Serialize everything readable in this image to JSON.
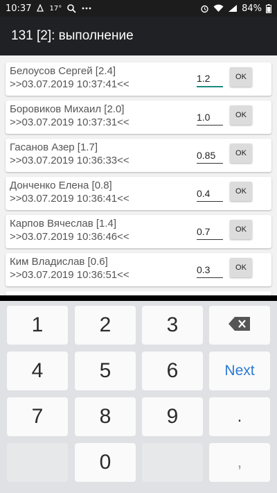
{
  "status_bar": {
    "time": "10:37",
    "temp": "17°",
    "battery": "84%"
  },
  "app_bar": {
    "title": "131 [2]: выполнение"
  },
  "items": [
    {
      "name": "Белоусов Сергей [2.4]",
      "time": ">>03.07.2019 10:37:41<<",
      "value": "1.2",
      "ok": "OK"
    },
    {
      "name": "Боровиков Михаил [2.0]",
      "time": ">>03.07.2019 10:37:31<<",
      "value": "1.0",
      "ok": "OK"
    },
    {
      "name": "Гасанов Азер [1.7]",
      "time": ">>03.07.2019 10:36:33<<",
      "value": "0.85",
      "ok": "OK"
    },
    {
      "name": "Донченко Елена [0.8]",
      "time": ">>03.07.2019 10:36:41<<",
      "value": "0.4",
      "ok": "OK"
    },
    {
      "name": "Карпов Вячеслав [1.4]",
      "time": ">>03.07.2019 10:36:46<<",
      "value": "0.7",
      "ok": "OK"
    },
    {
      "name": "Ким Владислав [0.6]",
      "time": ">>03.07.2019 10:36:51<<",
      "value": "0.3",
      "ok": "OK"
    }
  ],
  "keyboard": {
    "keys": [
      "1",
      "2",
      "3",
      "4",
      "5",
      "6",
      "7",
      "8",
      "9",
      "0"
    ],
    "next": "Next",
    "dot": ".",
    "comma": ","
  }
}
